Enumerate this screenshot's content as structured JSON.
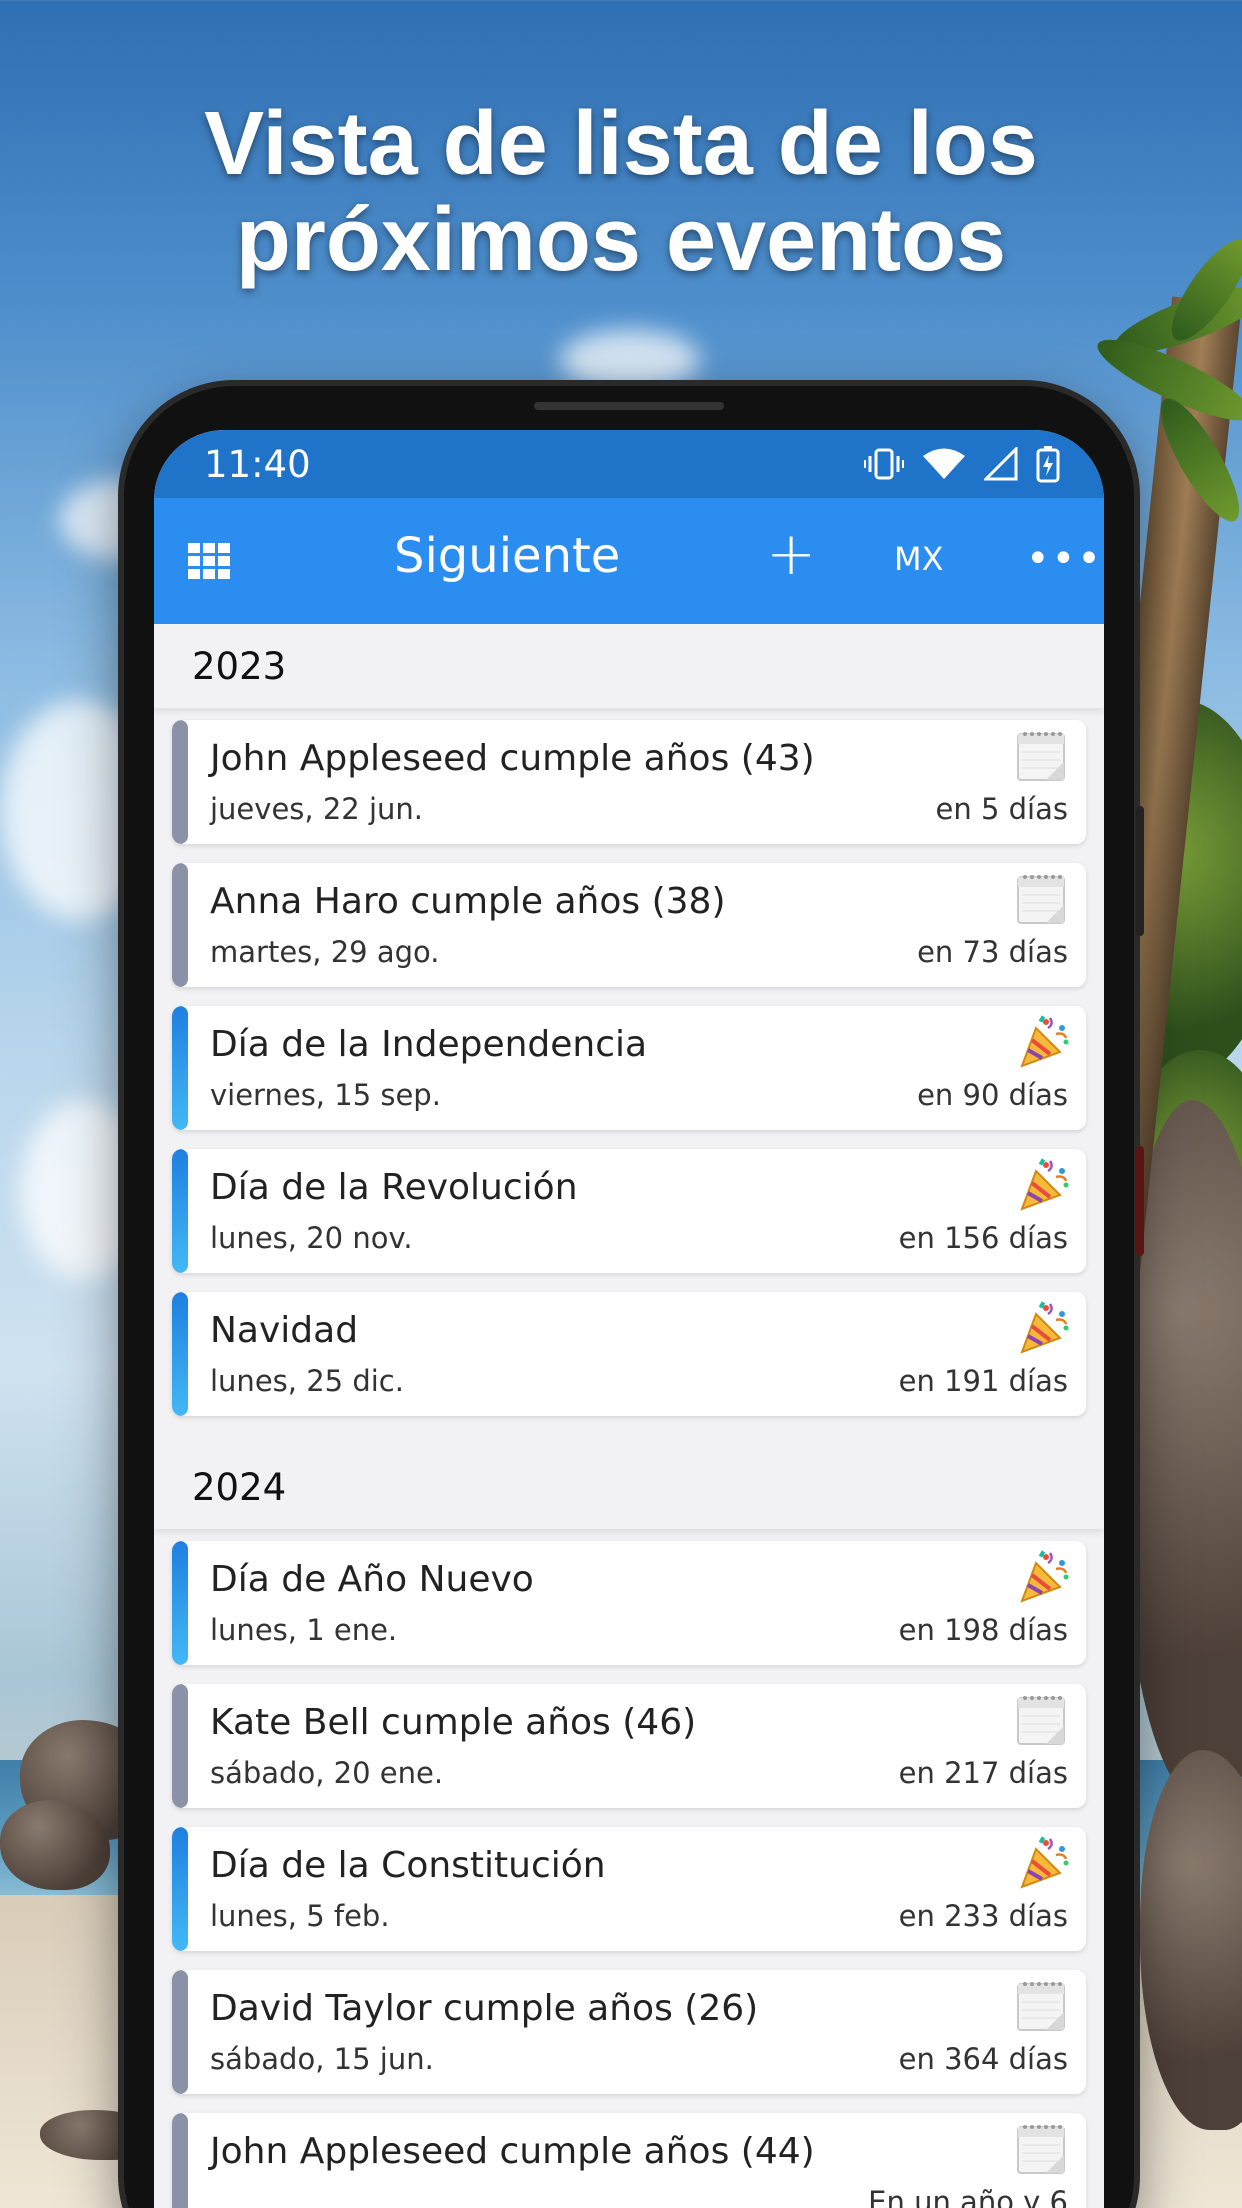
{
  "headline": {
    "line1": "Vista de lista de los",
    "line2": "próximos eventos"
  },
  "status_bar": {
    "time": "11:40",
    "icons": [
      "vibrate-icon",
      "wifi-icon",
      "signal-icon",
      "battery-charging-icon"
    ]
  },
  "app_bar": {
    "title": "Siguiente",
    "add_label": "+",
    "country_label": "MX",
    "more_label": "•••",
    "colors": {
      "status": "#1f73c8",
      "bar": "#2b8df0"
    }
  },
  "sections": [
    {
      "year": "2023",
      "events": [
        {
          "title": "John Appleseed cumple años (43)",
          "date": "jueves, 22 jun.",
          "relative": "en 5 días",
          "kind": "birthday",
          "icon": "calendar-icon"
        },
        {
          "title": "Anna Haro cumple años (38)",
          "date": "martes, 29 ago.",
          "relative": "en 73 días",
          "kind": "birthday",
          "icon": "calendar-icon"
        },
        {
          "title": "Día de la Independencia",
          "date": "viernes, 15 sep.",
          "relative": "en 90 días",
          "kind": "holiday",
          "icon": "party-popper-icon"
        },
        {
          "title": "Día de la Revolución",
          "date": "lunes, 20 nov.",
          "relative": "en 156 días",
          "kind": "holiday",
          "icon": "party-popper-icon"
        },
        {
          "title": "Navidad",
          "date": "lunes, 25 dic.",
          "relative": "en 191 días",
          "kind": "holiday",
          "icon": "party-popper-icon"
        }
      ]
    },
    {
      "year": "2024",
      "events": [
        {
          "title": "Día de Año Nuevo",
          "date": "lunes, 1 ene.",
          "relative": "en 198 días",
          "kind": "holiday",
          "icon": "party-popper-icon"
        },
        {
          "title": "Kate Bell cumple años (46)",
          "date": "sábado, 20 ene.",
          "relative": "en 217 días",
          "kind": "birthday",
          "icon": "calendar-icon"
        },
        {
          "title": "Día de la Constitución",
          "date": "lunes, 5 feb.",
          "relative": "en 233 días",
          "kind": "holiday",
          "icon": "party-popper-icon"
        },
        {
          "title": "David Taylor cumple años (26)",
          "date": "sábado, 15 jun.",
          "relative": "en 364 días",
          "kind": "birthday",
          "icon": "calendar-icon"
        },
        {
          "title": "John Appleseed cumple años (44)",
          "date": "",
          "relative": "En un año y 6",
          "kind": "birthday",
          "icon": "calendar-icon"
        }
      ]
    }
  ]
}
